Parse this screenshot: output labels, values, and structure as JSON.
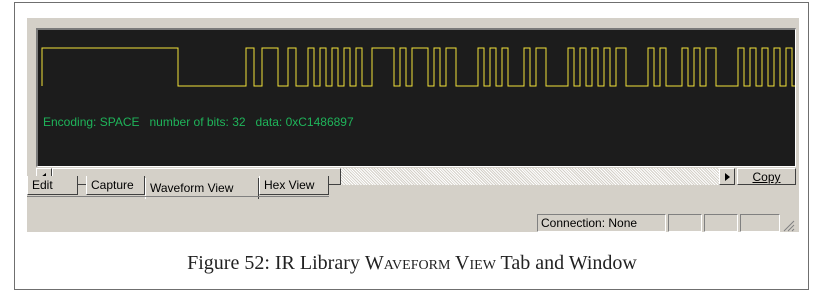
{
  "waveform": {
    "color": "#f2e23a",
    "decode_text": "Encoding: SPACE   number of bits: 32   data: 0xC1486897",
    "decode_color": "#1fb45a"
  },
  "scrollbar": {
    "copy_label": "Copy"
  },
  "tabs": [
    {
      "label": "Edit",
      "active": false
    },
    {
      "label": "Capture",
      "active": false
    },
    {
      "label": "Waveform View",
      "active": true
    },
    {
      "label": "Hex View",
      "active": false
    }
  ],
  "status": {
    "connection": "Connection: None"
  },
  "caption": {
    "prefix": "Figure 52: IR Library ",
    "smallcaps": "Waveform View",
    "suffix": " Tab and Window"
  }
}
